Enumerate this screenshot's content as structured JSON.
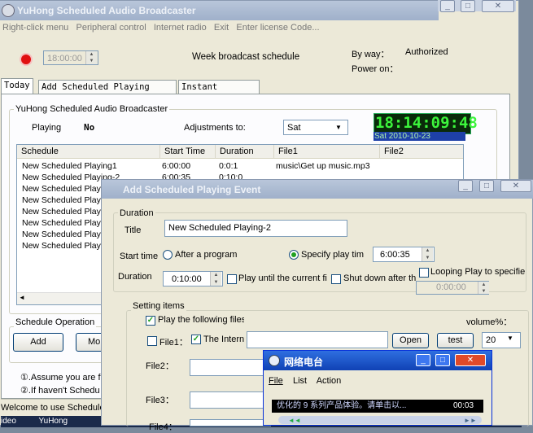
{
  "main": {
    "title": "YuHong Scheduled Audio Broadcaster",
    "menu": [
      "Right-click menu",
      "Peripheral control",
      "Internet radio",
      "Exit",
      "Enter license Code..."
    ],
    "time_value": "18:00:00",
    "week_schedule": "Week  broadcast schedule",
    "by_way_label": "By way：",
    "by_way_value": "Authorized",
    "power_on_label": "Power on：",
    "tabs": [
      "Today",
      "Add Scheduled Playing Event",
      "Instant Playing"
    ],
    "group_title": "YuHong Scheduled Audio Broadcaster",
    "playing_label": "Playing",
    "playing_value": "No",
    "adjust_label": "Adjustments to:",
    "adjust_value": "Sat",
    "clock": "18:14:09:48",
    "clock_date": "Sat 2010-10-23",
    "columns": [
      "Schedule",
      "Start Time",
      "Duration",
      "File1",
      "File2"
    ],
    "rows": [
      {
        "schedule": "New Scheduled Playing1",
        "start": "6:00:00",
        "duration": "0:0:1",
        "file1": "music\\Get up music.mp3"
      },
      {
        "schedule": "New Scheduled Playing-2",
        "start": "6:00:35",
        "duration": "0:10:0",
        "file1": ""
      },
      {
        "schedule": "New Scheduled Play",
        "start": "",
        "duration": "",
        "file1": ""
      },
      {
        "schedule": "New Scheduled Play",
        "start": "",
        "duration": "",
        "file1": ""
      },
      {
        "schedule": "New Scheduled Play",
        "start": "",
        "duration": "",
        "file1": ""
      },
      {
        "schedule": "New Scheduled Play",
        "start": "",
        "duration": "",
        "file1": ""
      },
      {
        "schedule": "New Scheduled Play",
        "start": "",
        "duration": "",
        "file1": ""
      },
      {
        "schedule": "New Scheduled Play",
        "start": "",
        "duration": "",
        "file1": ""
      }
    ],
    "ops_title": "Schedule Operation",
    "add_btn": "Add",
    "mod_btn": "Mo",
    "note1": "①.Assume you are f",
    "note2": "②.If haven't  Schedu",
    "status": "Welcome to use  Schedule",
    "taskbar_text": "ideo          YuHong"
  },
  "dialog": {
    "title": "Add Scheduled Playing Event",
    "duration_group": "Duration",
    "title_label": "Title",
    "title_value": "New Scheduled Playing-2",
    "start_time_label": "Start time",
    "after_program": "After a program",
    "specify_time": "Specify play tim",
    "start_value": "6:00:35",
    "duration_label": "Duration",
    "duration_value": "0:10:00",
    "play_until": "Play until the current fi",
    "shut_down": "Shut down after th",
    "looping": "Looping Play to specifie",
    "loop_value": "0:00:00",
    "settings_group": "Setting items",
    "play_following": "Play the following files",
    "volume_label": "volume%：",
    "volume_value": "20",
    "file1_label": "File1：",
    "internet_label": "The Intern",
    "open_btn": "Open",
    "test_btn": "test",
    "file2_label": "File2：",
    "file3_label": "File3：",
    "file4_label": "File4："
  },
  "radio": {
    "title": "网络电台",
    "menu": [
      "File",
      "List",
      "Action"
    ],
    "marquee": "优化的 9 系列产品体验。请单击以...",
    "time": "00:03"
  }
}
